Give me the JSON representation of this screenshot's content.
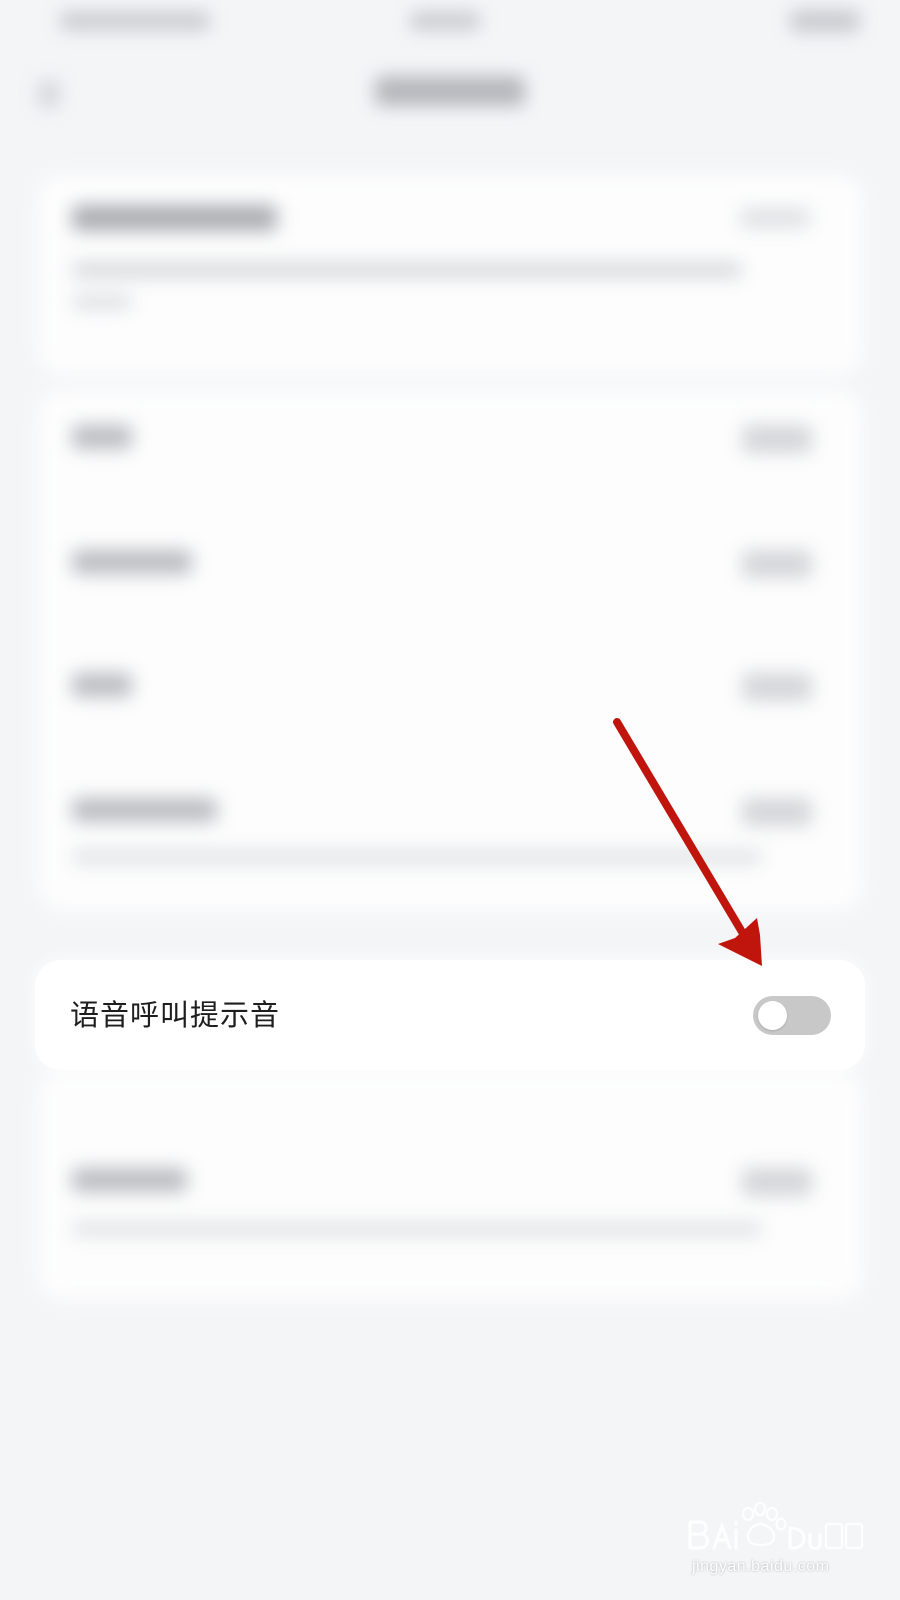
{
  "setting_row": {
    "label": "语音呼叫提示音",
    "toggle_on": false
  },
  "colors": {
    "background": "#f4f5f7",
    "card": "#ffffff",
    "toggle_off_track": "#c8c8c8",
    "arrow": "#c0150c"
  },
  "watermark": {
    "brand": "Bai du 经验",
    "url": "jingyan.baidu.com"
  }
}
